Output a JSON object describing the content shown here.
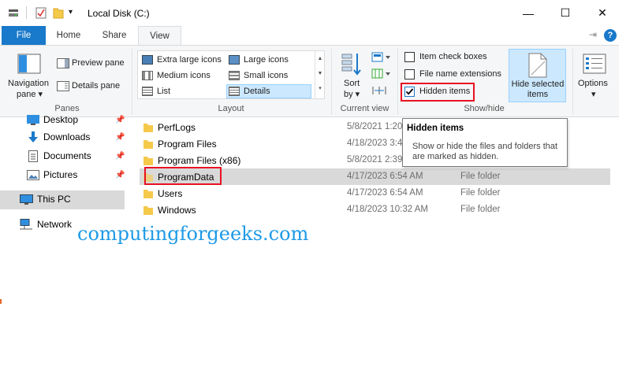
{
  "window": {
    "title": "Local Disk (C:)",
    "controls": {
      "minimize": "—",
      "maximize": "☐",
      "close": "✕"
    }
  },
  "ribbon_tabs": [
    "File",
    "Home",
    "Share",
    "View"
  ],
  "active_tab": "View",
  "panes_group": {
    "label": "Panes",
    "navigation_pane_line1": "Navigation",
    "navigation_pane_line2": "pane",
    "preview_pane": "Preview pane",
    "details_pane": "Details pane"
  },
  "layout_group": {
    "label": "Layout",
    "options": [
      "Extra large icons",
      "Large icons",
      "Medium icons",
      "Small icons",
      "List",
      "Details"
    ],
    "selected": "Details"
  },
  "current_view_group": {
    "label": "Current view",
    "sort_line1": "Sort",
    "sort_line2": "by"
  },
  "show_hide_group": {
    "label": "Show/hide",
    "item_check_boxes": {
      "label": "Item check boxes",
      "checked": false
    },
    "file_name_extensions": {
      "label": "File name extensions",
      "checked": false
    },
    "hidden_items": {
      "label": "Hidden items",
      "checked": true
    },
    "hide_selected_line1": "Hide selected",
    "hide_selected_line2": "items"
  },
  "options_label": "Options",
  "navigation": [
    {
      "label": "Desktop",
      "icon": "desktop-icon",
      "pinned": true
    },
    {
      "label": "Downloads",
      "icon": "download-icon",
      "pinned": true
    },
    {
      "label": "Documents",
      "icon": "documents-icon",
      "pinned": true
    },
    {
      "label": "Pictures",
      "icon": "pictures-icon",
      "pinned": true
    },
    {
      "label": "This PC",
      "icon": "computer-icon",
      "pinned": false,
      "selected": true
    },
    {
      "label": "Network",
      "icon": "network-icon",
      "pinned": false
    }
  ],
  "files": [
    {
      "name": "PerfLogs",
      "date": "5/8/2021 1:20",
      "type": ""
    },
    {
      "name": "Program Files",
      "date": "4/18/2023 3:4",
      "type": ""
    },
    {
      "name": "Program Files (x86)",
      "date": "5/8/2021 2:39",
      "type": ""
    },
    {
      "name": "ProgramData",
      "date": "4/17/2023 6:54 AM",
      "type": "File folder",
      "selected": true
    },
    {
      "name": "Users",
      "date": "4/17/2023 6:54 AM",
      "type": "File folder"
    },
    {
      "name": "Windows",
      "date": "4/18/2023 10:32 AM",
      "type": "File folder"
    }
  ],
  "tooltip": {
    "title": "Hidden items",
    "body": "Show or hide the files and folders that are marked as hidden."
  },
  "watermark": "computingforgeeks.com",
  "colors": {
    "file_tab": "#1979ca",
    "accent_blue": "#1979ca",
    "selection": "#d9d9d9",
    "highlight_red": "#e81123",
    "watermark": "#1e9ae6",
    "folder": "#f5c94a"
  }
}
